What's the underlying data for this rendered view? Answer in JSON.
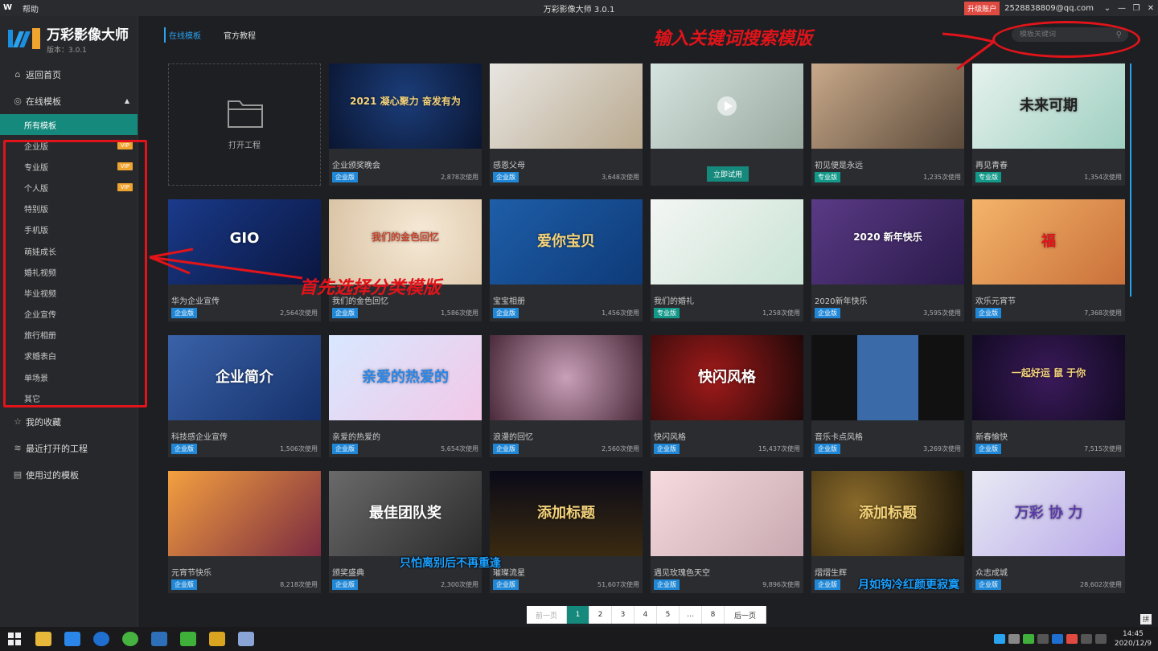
{
  "titlebar": {
    "logo": "W",
    "help": "帮助",
    "title": "万彩影像大师 3.0.1",
    "upgrade": "升级账户",
    "account": "2528838809@qq.com",
    "controls": [
      "⌄",
      "—",
      "❐",
      "✕"
    ]
  },
  "brand": {
    "name": "万彩影像大师",
    "version": "版本：3.0.1"
  },
  "nav": {
    "home": "返回首页",
    "online": "在线模板",
    "all": "所有模板",
    "categories": [
      {
        "label": "企业版",
        "vip": "VIP"
      },
      {
        "label": "专业版",
        "vip": "VIP"
      },
      {
        "label": "个人版",
        "vip": "VIP"
      },
      {
        "label": "特别版",
        "vip": ""
      },
      {
        "label": "手机版",
        "vip": ""
      },
      {
        "label": "萌娃成长",
        "vip": ""
      },
      {
        "label": "婚礼视频",
        "vip": ""
      },
      {
        "label": "毕业视频",
        "vip": ""
      },
      {
        "label": "企业宣传",
        "vip": ""
      },
      {
        "label": "旅行相册",
        "vip": ""
      },
      {
        "label": "求婚表白",
        "vip": ""
      },
      {
        "label": "单场景",
        "vip": ""
      },
      {
        "label": "其它",
        "vip": ""
      }
    ],
    "favorites": "我的收藏",
    "recent": "最近打开的工程",
    "used": "使用过的模板"
  },
  "tabs": [
    "在线模板",
    "官方教程"
  ],
  "search": {
    "placeholder": "模板关键词"
  },
  "open_project": "打开工程",
  "try_now": "立即试用",
  "cards": [
    {
      "name": "企业颁奖晚会",
      "badge": "企业版",
      "uses": "2,878次使用",
      "thumb_text": "2021 凝心聚力 奋发有为"
    },
    {
      "name": "感恩父母",
      "badge": "企业版",
      "uses": "3,648次使用",
      "thumb_text": ""
    },
    {
      "name": "",
      "badge": "",
      "uses": "",
      "thumb_text": ""
    },
    {
      "name": "初见便是永远",
      "badge": "专业版",
      "uses": "1,235次使用",
      "thumb_text": ""
    },
    {
      "name": "再见青春",
      "badge": "专业版",
      "uses": "1,354次使用",
      "thumb_text": "未来可期"
    },
    {
      "name": "华为企业宣传",
      "badge": "企业版",
      "uses": "2,564次使用",
      "thumb_text": "GIO"
    },
    {
      "name": "我们的金色回忆",
      "badge": "企业版",
      "uses": "1,586次使用",
      "thumb_text": "我们的金色回忆"
    },
    {
      "name": "宝宝相册",
      "badge": "企业版",
      "uses": "1,456次使用",
      "thumb_text": "爱你宝贝"
    },
    {
      "name": "我们的婚礼",
      "badge": "专业版",
      "uses": "1,258次使用",
      "thumb_text": ""
    },
    {
      "name": "2020新年快乐",
      "badge": "企业版",
      "uses": "3,595次使用",
      "thumb_text": "2020 新年快乐"
    },
    {
      "name": "欢乐元宵节",
      "badge": "企业版",
      "uses": "7,368次使用",
      "thumb_text": "福"
    },
    {
      "name": "科技感企业宣传",
      "badge": "企业版",
      "uses": "1,506次使用",
      "thumb_text": "企业简介"
    },
    {
      "name": "亲爱的热爱的",
      "badge": "企业版",
      "uses": "5,654次使用",
      "thumb_text": "亲爱的热爱的"
    },
    {
      "name": "浪漫的回忆",
      "badge": "企业版",
      "uses": "2,560次使用",
      "thumb_text": ""
    },
    {
      "name": "快闪风格",
      "badge": "企业版",
      "uses": "15,437次使用",
      "thumb_text": "快闪风格"
    },
    {
      "name": "音乐卡点风格",
      "badge": "企业版",
      "uses": "3,269次使用",
      "thumb_text": ""
    },
    {
      "name": "新春愉快",
      "badge": "企业版",
      "uses": "7,515次使用",
      "thumb_text": "一起好运 鼠 于你"
    },
    {
      "name": "元宵节快乐",
      "badge": "企业版",
      "uses": "8,218次使用",
      "thumb_text": ""
    },
    {
      "name": "颁奖盛典",
      "badge": "企业版",
      "uses": "2,300次使用",
      "thumb_text": "最佳团队奖"
    },
    {
      "name": "璀璨流星",
      "badge": "企业版",
      "uses": "51,607次使用",
      "thumb_text": "添加标题"
    },
    {
      "name": "遇见玫瑰色天空",
      "badge": "企业版",
      "uses": "9,896次使用",
      "thumb_text": ""
    },
    {
      "name": "熠熠生辉",
      "badge": "企业版",
      "uses": "",
      "thumb_text": "添加标题"
    },
    {
      "name": "众志成城",
      "badge": "企业版",
      "uses": "28,602次使用",
      "thumb_text": "万彩 协 力"
    }
  ],
  "pager": {
    "prev": "前一页",
    "pages": [
      "1",
      "2",
      "3",
      "4",
      "5",
      "...",
      "8"
    ],
    "next": "后一页"
  },
  "annotations": {
    "search_hint": "输入关键词搜索模版",
    "category_hint": "首先选择分类模版"
  },
  "subtitles": [
    "只怕离别后不再重逢",
    "月如钩冷红颜更寂寞"
  ],
  "taskbar": {
    "time": "14:45",
    "date": "2020/12/9",
    "ime": "拼"
  },
  "colors": {
    "accent": "#14897c",
    "link": "#2aa3f0",
    "badge_enterprise": "#1f87d6",
    "badge_pro": "#13998a",
    "vip": "#f0a430",
    "annotation": "#e0141a"
  }
}
